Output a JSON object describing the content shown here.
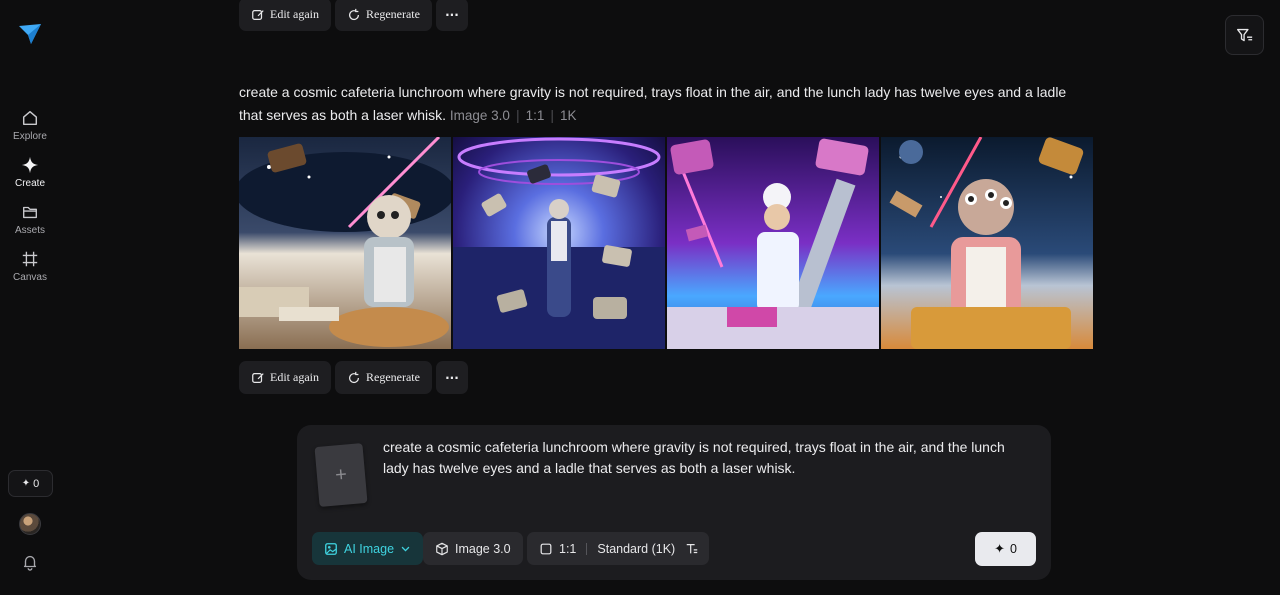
{
  "sidebar": {
    "items": [
      {
        "label": "Explore",
        "icon": "home-icon"
      },
      {
        "label": "Create",
        "icon": "sparkle-icon"
      },
      {
        "label": "Assets",
        "icon": "folder-icon"
      },
      {
        "label": "Canvas",
        "icon": "canvas-icon"
      }
    ],
    "credits": "0"
  },
  "actions": {
    "edit_again": "Edit again",
    "regenerate": "Regenerate",
    "more": "···"
  },
  "result": {
    "prompt": "create a cosmic cafeteria lunchroom where gravity is not required, trays float in the air, and the lunch lady has twelve eyes and a ladle that serves as both a laser whisk.",
    "model": "Image 3.0",
    "ratio": "1:1",
    "resolution": "1K"
  },
  "composer": {
    "text": "create a cosmic cafeteria lunchroom where gravity is not required, trays float in the air, and the lunch lady has twelve eyes and a ladle that serves as both a laser whisk.",
    "mode": "AI Image",
    "model": "Image 3.0",
    "ratio": "1:1",
    "quality": "Standard (1K)",
    "generate_cost": "0"
  },
  "colors": {
    "accent": "#3fd3e0",
    "logo": "#3fa9f5"
  }
}
